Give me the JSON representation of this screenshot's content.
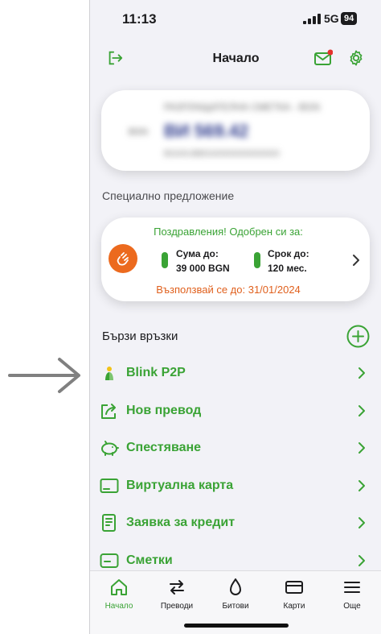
{
  "status_bar": {
    "time": "11:13",
    "network": "5G",
    "battery": "94"
  },
  "header": {
    "title": "Начало"
  },
  "account": {
    "name": "РАЗПЛАЩАТЕЛНА СМЕТКА - BGN",
    "amount": "ВИ 569.42",
    "iban": "BG00UBBS00000000000000",
    "currency": "BGN"
  },
  "offer": {
    "section_label": "Специално предложение",
    "heading": "Поздравления! Одобрен си за:",
    "amount_label": "Сума до:",
    "amount_value": "39 000 BGN",
    "term_label": "Срок до:",
    "term_value": "120 мес.",
    "deadline": "Възползвай се до: 31/01/2024"
  },
  "quick_links": {
    "title": "Бързи връзки",
    "items": [
      {
        "label": "Blink P2P",
        "icon": "blink-logo-icon"
      },
      {
        "label": "Нов превод",
        "icon": "share-transfer-icon"
      },
      {
        "label": "Спестяване",
        "icon": "piggy-bank-icon"
      },
      {
        "label": "Виртуална карта",
        "icon": "card-icon"
      },
      {
        "label": "Заявка за кредит",
        "icon": "document-icon"
      },
      {
        "label": "Сметки",
        "icon": "wallet-icon"
      }
    ]
  },
  "tabs": [
    {
      "label": "Начало",
      "icon": "home-icon",
      "active": true
    },
    {
      "label": "Преводи",
      "icon": "transfer-arrows-icon",
      "active": false
    },
    {
      "label": "Битови",
      "icon": "drop-icon",
      "active": false
    },
    {
      "label": "Карти",
      "icon": "card-icon",
      "active": false
    },
    {
      "label": "Още",
      "icon": "menu-icon",
      "active": false
    }
  ],
  "colors": {
    "accent": "#3aa335",
    "offer_badge": "#ec6a1e",
    "deadline": "#e0601d",
    "pointer_arrow": "#808080"
  }
}
